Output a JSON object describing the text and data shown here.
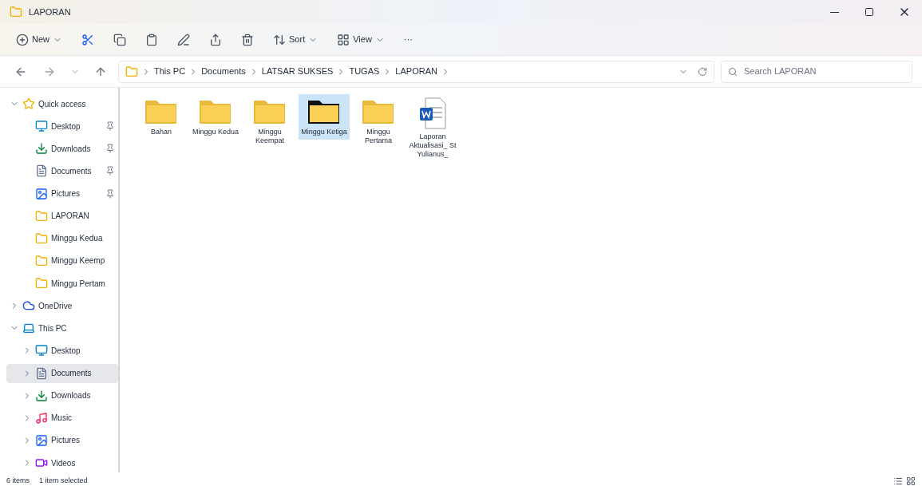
{
  "window": {
    "title": "LAPORAN"
  },
  "toolbar": {
    "items": [
      {
        "kind": "new",
        "label": "New"
      },
      {
        "kind": "cut"
      },
      {
        "kind": "copy"
      },
      {
        "kind": "paste"
      },
      {
        "kind": "rename"
      },
      {
        "kind": "share"
      },
      {
        "kind": "delete"
      },
      {
        "kind": "sort",
        "label": "Sort"
      },
      {
        "kind": "view",
        "label": "View"
      },
      {
        "kind": "more",
        "label": "···"
      }
    ]
  },
  "address_bar": {
    "path": [
      "This PC",
      "Documents",
      "LATSAR SUKSES",
      "TUGAS",
      "LAPORAN"
    ]
  },
  "search": {
    "placeholder": "Search LAPORAN"
  },
  "sidebar": {
    "items": [
      {
        "label": "Quick access",
        "kind": "star",
        "expanded": true,
        "selected": false,
        "children": [
          {
            "label": "Desktop",
            "kind": "desktop",
            "pinned": true,
            "selected": false
          },
          {
            "label": "Downloads",
            "kind": "download",
            "pinned": true,
            "selected": false
          },
          {
            "label": "Documents",
            "kind": "document",
            "pinned": true,
            "selected": false
          },
          {
            "label": "Pictures",
            "kind": "picture",
            "pinned": true,
            "selected": false
          },
          {
            "label": "LAPORAN",
            "kind": "folder",
            "pinned": false,
            "selected": false
          },
          {
            "label": "Minggu Kedua",
            "kind": "folder",
            "pinned": false,
            "selected": false
          },
          {
            "label": "Minggu Keemp",
            "kind": "folder",
            "pinned": false,
            "selected": false
          },
          {
            "label": "Minggu Pertam",
            "kind": "folder",
            "pinned": false,
            "selected": false
          }
        ]
      },
      {
        "label": "OneDrive",
        "kind": "cloud",
        "expanded": false,
        "selected": false
      },
      {
        "label": "This PC",
        "kind": "pc",
        "expanded": true,
        "selected": false,
        "children": [
          {
            "label": "Desktop",
            "kind": "desktop",
            "expanded": false,
            "selected": false
          },
          {
            "label": "Documents",
            "kind": "document",
            "expanded": false,
            "selected": true
          },
          {
            "label": "Downloads",
            "kind": "download",
            "expanded": false,
            "selected": false
          },
          {
            "label": "Music",
            "kind": "music",
            "expanded": false,
            "selected": false
          },
          {
            "label": "Pictures",
            "kind": "picture",
            "expanded": false,
            "selected": false
          },
          {
            "label": "Videos",
            "kind": "video",
            "expanded": false,
            "selected": false
          }
        ]
      }
    ]
  },
  "files": [
    {
      "name": "Bahan",
      "kind": "folder",
      "selected": false
    },
    {
      "name": "Minggu Kedua",
      "kind": "folder",
      "selected": false
    },
    {
      "name": "Minggu Keempat",
      "kind": "folder",
      "selected": false
    },
    {
      "name": "Minggu Ketiga",
      "kind": "folder",
      "selected": true
    },
    {
      "name": "Minggu Pertama",
      "kind": "folder",
      "selected": false
    },
    {
      "name": "Laporan Aktualisasi_ St Yulianus_",
      "kind": "word",
      "selected": false
    }
  ],
  "status_bar": {
    "count": "6 items",
    "selection": "1 item selected"
  }
}
